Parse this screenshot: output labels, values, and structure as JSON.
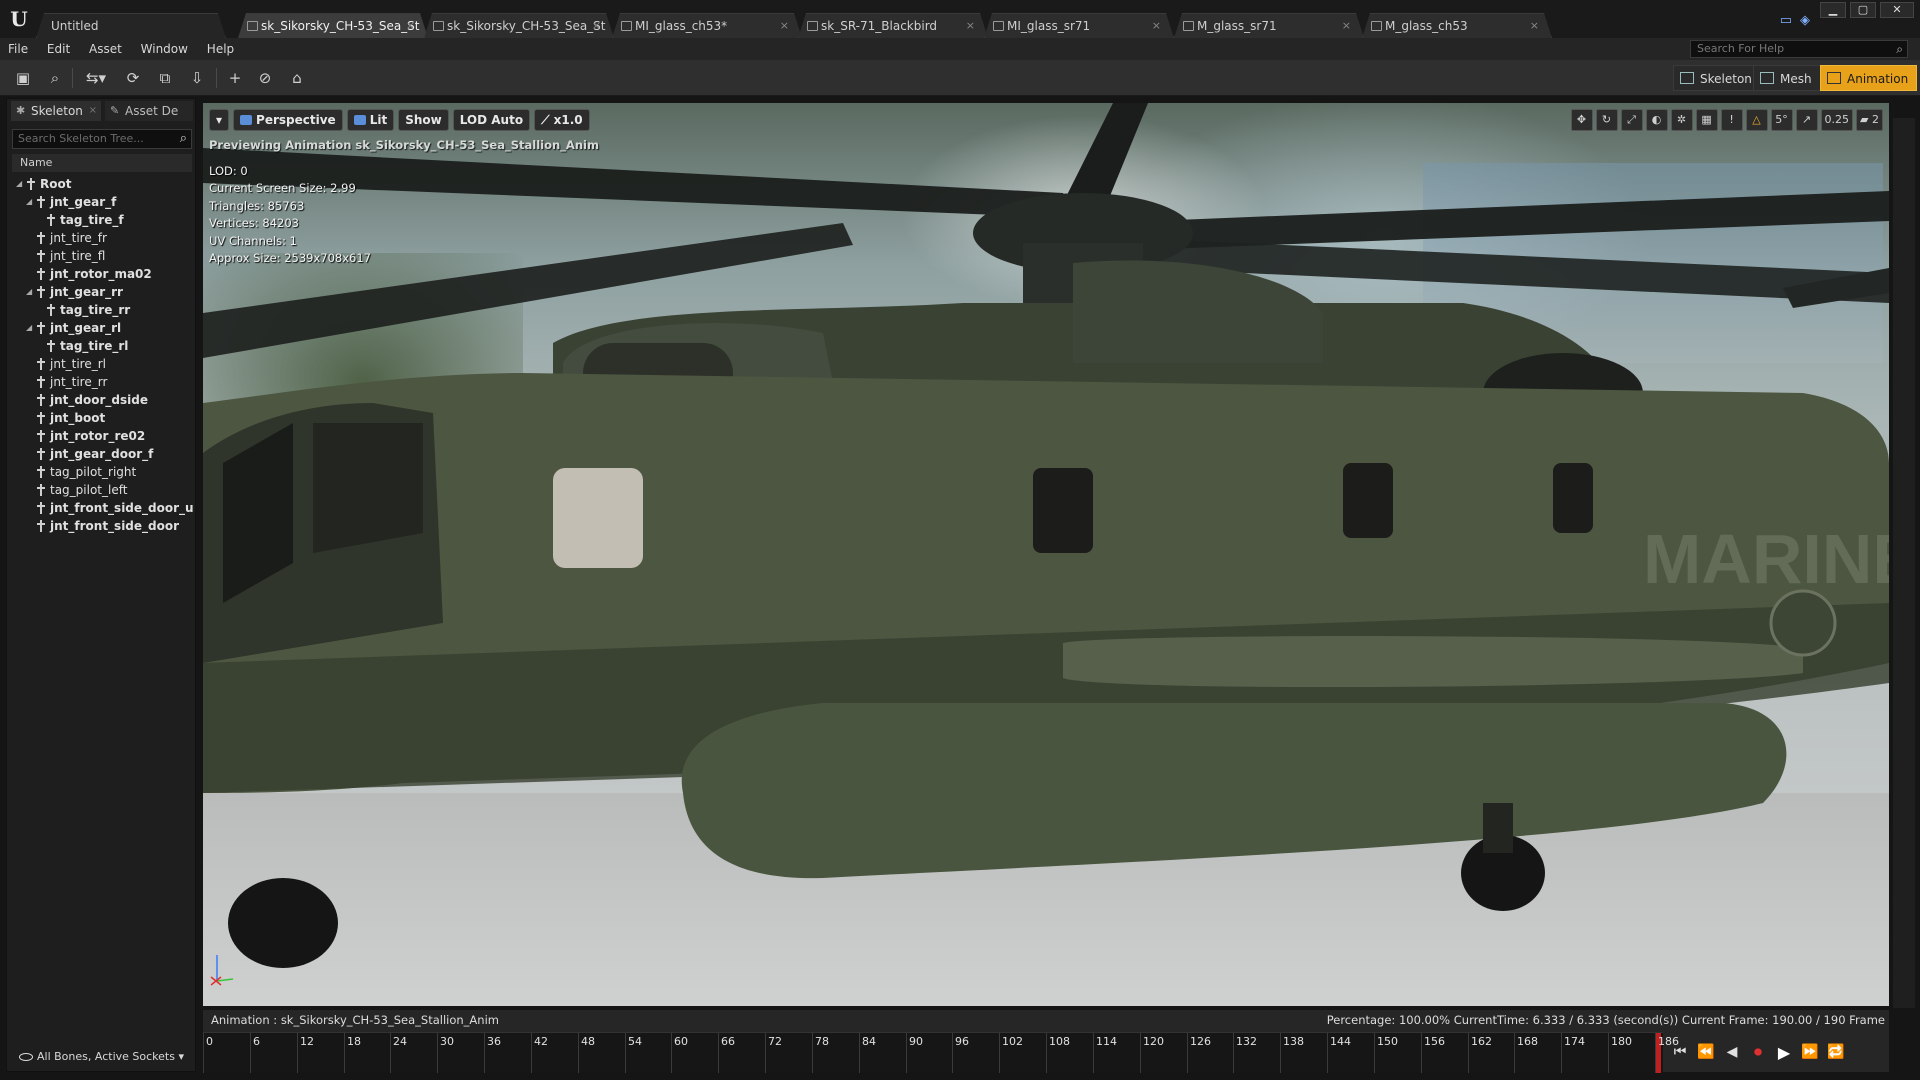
{
  "title_bar": {
    "tabs": [
      {
        "label": "Untitled",
        "close": ""
      },
      {
        "label": "sk_Sikorsky_CH-53_Sea_St",
        "close": "×"
      },
      {
        "label": "sk_Sikorsky_CH-53_Sea_St",
        "close": "×"
      },
      {
        "label": "MI_glass_ch53*",
        "close": "×"
      },
      {
        "label": "sk_SR-71_Blackbird",
        "close": "×"
      },
      {
        "label": "MI_glass_sr71",
        "close": "×"
      },
      {
        "label": "M_glass_sr71",
        "close": "×"
      },
      {
        "label": "M_glass_ch53",
        "close": "×"
      }
    ],
    "window_buttons": {
      "minimize": "▁",
      "maximize": "▢",
      "close": "✕"
    }
  },
  "menu": {
    "items": [
      "File",
      "Edit",
      "Asset",
      "Window",
      "Help"
    ],
    "help_search_placeholder": "Search For Help"
  },
  "toolbar": {
    "modes": [
      {
        "label": "Skeleton",
        "icon": "skeleton-icon"
      },
      {
        "label": "Mesh",
        "icon": "mesh-icon"
      },
      {
        "label": "Animation",
        "icon": "animation-icon",
        "active": true
      }
    ],
    "accent_color": "#e8a21a"
  },
  "left_panel": {
    "tabs": [
      {
        "label": "Skeleton",
        "close": "×"
      },
      {
        "label": "Asset De",
        "close": ""
      }
    ],
    "search_placeholder": "Search Skeleton Tree...",
    "column_header": "Name",
    "bones": [
      {
        "name": "Root",
        "depth": 0,
        "expand": "◢",
        "bold": true
      },
      {
        "name": "jnt_gear_f",
        "depth": 1,
        "expand": "◢",
        "bold": true
      },
      {
        "name": "tag_tire_f",
        "depth": 2,
        "expand": "",
        "bold": true
      },
      {
        "name": "jnt_tire_fr",
        "depth": 1,
        "expand": "",
        "bold": false
      },
      {
        "name": "jnt_tire_fl",
        "depth": 1,
        "expand": "",
        "bold": false
      },
      {
        "name": "jnt_rotor_ma02",
        "depth": 1,
        "expand": "",
        "bold": true
      },
      {
        "name": "jnt_gear_rr",
        "depth": 1,
        "expand": "◢",
        "bold": true
      },
      {
        "name": "tag_tire_rr",
        "depth": 2,
        "expand": "",
        "bold": true
      },
      {
        "name": "jnt_gear_rl",
        "depth": 1,
        "expand": "◢",
        "bold": true
      },
      {
        "name": "tag_tire_rl",
        "depth": 2,
        "expand": "",
        "bold": true
      },
      {
        "name": "jnt_tire_rl",
        "depth": 1,
        "expand": "",
        "bold": false
      },
      {
        "name": "jnt_tire_rr",
        "depth": 1,
        "expand": "",
        "bold": false
      },
      {
        "name": "jnt_door_dside",
        "depth": 1,
        "expand": "",
        "bold": true
      },
      {
        "name": "jnt_boot",
        "depth": 1,
        "expand": "",
        "bold": true
      },
      {
        "name": "jnt_rotor_re02",
        "depth": 1,
        "expand": "",
        "bold": true
      },
      {
        "name": "jnt_gear_door_f",
        "depth": 1,
        "expand": "",
        "bold": true
      },
      {
        "name": "tag_pilot_right",
        "depth": 1,
        "expand": "",
        "bold": false
      },
      {
        "name": "tag_pilot_left",
        "depth": 1,
        "expand": "",
        "bold": false
      },
      {
        "name": "jnt_front_side_door_uppe",
        "depth": 1,
        "expand": "",
        "bold": true
      },
      {
        "name": "jnt_front_side_door",
        "depth": 1,
        "expand": "",
        "bold": true
      }
    ],
    "filter_label": "All Bones, Active Sockets ▾"
  },
  "viewport": {
    "buttons": {
      "menu": "▾",
      "perspective": "Perspective",
      "lit": "Lit",
      "show": "Show",
      "lod": "LOD Auto",
      "speed": "x1.0"
    },
    "right_tools": {
      "angle_snap": "5°",
      "scale_snap": "0.25",
      "camera_speed": "2"
    },
    "preview_text": "Previewing Animation sk_Sikorsky_CH-53_Sea_Stallion_Anim",
    "stats": [
      "LOD: 0",
      "Current Screen Size: 2.99",
      "Triangles: 85763",
      "Vertices: 84203",
      "UV Channels: 1",
      "Approx Size: 2539x708x617"
    ],
    "fuselage_text": "MARINES"
  },
  "animation_bar": {
    "name_label": "Animation :  sk_Sikorsky_CH-53_Sea_Stallion_Anim",
    "stats": "Percentage:  100.00%  CurrentTime:  6.333 / 6.333 (second(s)) Current Frame:  190.00 / 190 Frame",
    "frame_ticks": [
      "0",
      "6",
      "12",
      "18",
      "24",
      "30",
      "36",
      "42",
      "48",
      "54",
      "60",
      "66",
      "72",
      "78",
      "84",
      "90",
      "96",
      "102",
      "108",
      "114",
      "120",
      "126",
      "132",
      "138",
      "144",
      "150",
      "156",
      "162",
      "168",
      "174",
      "180",
      "186"
    ],
    "transport": {
      "to_start": "⏮",
      "step_back": "⏪",
      "reverse": "◀",
      "record": "⏺",
      "play": "▶",
      "step_forward": "⏩",
      "loop": "🔁"
    }
  }
}
